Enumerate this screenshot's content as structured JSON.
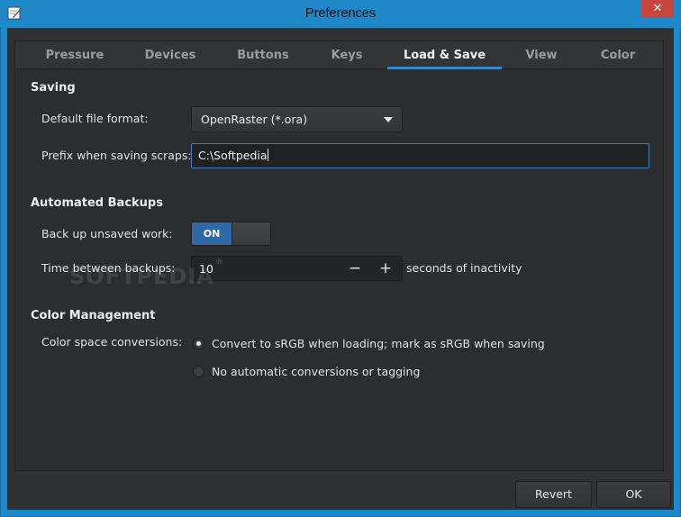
{
  "window": {
    "title": "Preferences",
    "close_glyph": "✕"
  },
  "tabs": [
    {
      "label": "Pressure"
    },
    {
      "label": "Devices"
    },
    {
      "label": "Buttons"
    },
    {
      "label": "Keys"
    },
    {
      "label": "Load & Save",
      "active": true
    },
    {
      "label": "View"
    },
    {
      "label": "Color"
    }
  ],
  "saving": {
    "title": "Saving",
    "format_label": "Default file format:",
    "format_value": "OpenRaster (*.ora)",
    "prefix_label": "Prefix when saving scraps:",
    "prefix_value": "C:\\Softpedia"
  },
  "backups": {
    "title": "Automated Backups",
    "backup_label": "Back up unsaved work:",
    "switch_state": "ON",
    "interval_label": "Time between backups:",
    "interval_value": "10",
    "interval_suffix": "seconds of inactivity",
    "minus_glyph": "−",
    "plus_glyph": "+"
  },
  "color_management": {
    "title": "Color Management",
    "conversions_label": "Color space conversions:",
    "options": [
      {
        "label": "Convert to sRGB when loading; mark as sRGB when saving",
        "selected": true
      },
      {
        "label": "No automatic conversions or tagging",
        "selected": false
      }
    ]
  },
  "watermark": {
    "text": "SOFTPEDIA",
    "mark": "®"
  },
  "buttons": {
    "revert": "Revert",
    "ok": "OK"
  },
  "colors": {
    "titlebar": "#1e88c8",
    "accent": "#3c83c6",
    "switch_on": "#2f6aa6",
    "close": "#c7463f",
    "background": "#2b2d2f"
  }
}
